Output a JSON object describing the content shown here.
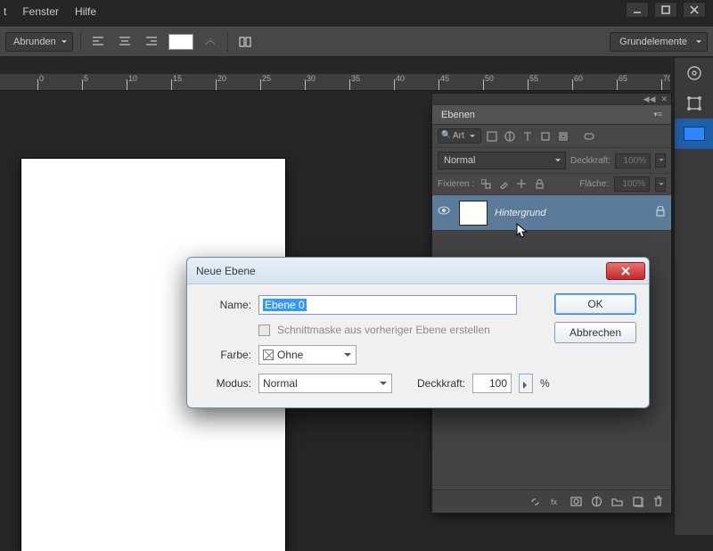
{
  "menu": {
    "item1": "Fenster",
    "item2": "Hilfe",
    "partial": "t"
  },
  "optbar": {
    "rounding": "Abrunden",
    "workspace": "Grundelemente"
  },
  "ruler": {
    "ticks": [
      0,
      5,
      10,
      15,
      20,
      25,
      30,
      35,
      40,
      45,
      50,
      55,
      60,
      65,
      70
    ]
  },
  "panel": {
    "title": "Ebenen",
    "filter": "Art",
    "blend": "Normal",
    "opacity_label": "Deckkraft:",
    "opacity_value": "100%",
    "lock_label": "Fixieren :",
    "fill_label": "Fläche:",
    "fill_value": "100%",
    "layer_name": "Hintergrund"
  },
  "dialog": {
    "title": "Neue Ebene",
    "name_label": "Name:",
    "name_value": "Ebene 0",
    "clip_label": "Schnittmaske aus vorheriger Ebene erstellen",
    "color_label": "Farbe:",
    "color_value": "Ohne",
    "mode_label": "Modus:",
    "mode_value": "Normal",
    "opacity_label": "Deckkraft:",
    "opacity_value": "100",
    "percent": "%",
    "ok": "OK",
    "cancel": "Abbrechen"
  }
}
